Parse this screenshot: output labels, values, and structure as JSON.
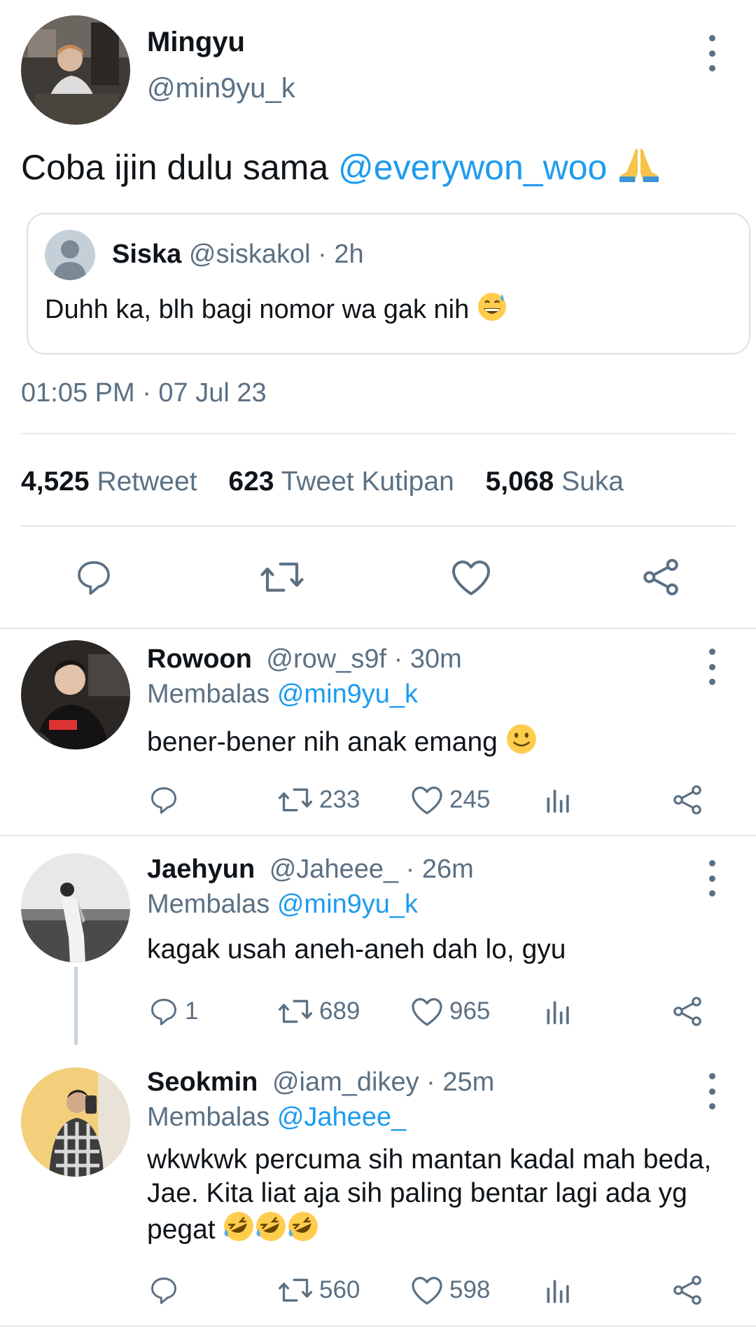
{
  "main_tweet": {
    "name": "Mingyu",
    "handle": "@min9yu_k",
    "text_prefix": "Coba ijin dulu sama ",
    "mention": "@everywon_woo",
    "emoji": "folded-hands",
    "quote": {
      "name": "Siska",
      "handle": "@siskakol",
      "separator": "·",
      "time": "2h",
      "text": "Duhh ka, blh bagi nomor wa gak nih",
      "emoji": "grinning-sweat"
    },
    "timestamp": "01:05 PM · 07 Jul 23",
    "stats": {
      "retweets": "4,525",
      "retweets_label": "Retweet",
      "quotes": "623",
      "quotes_label": "Tweet Kutipan",
      "likes": "5,068",
      "likes_label": "Suka"
    }
  },
  "replies": [
    {
      "name": "Rowoon",
      "meta": "@row_s9f · 30m",
      "reply_label": "Membalas ",
      "reply_to": "@min9yu_k",
      "text": "bener-bener nih anak emang",
      "emoji": "slightly-smiling",
      "replies_count": "",
      "retweets": "233",
      "likes": "245"
    },
    {
      "name": "Jaehyun",
      "meta": "@Jaheee_ · 26m",
      "reply_label": "Membalas ",
      "reply_to": "@min9yu_k",
      "text": "kagak usah aneh-aneh dah lo, gyu",
      "replies_count": "1",
      "retweets": "689",
      "likes": "965"
    },
    {
      "name": "Seokmin",
      "meta": "@iam_dikey · 25m",
      "reply_label": "Membalas ",
      "reply_to": "@Jaheee_",
      "text": "wkwkwk percuma sih mantan kadal mah beda, Jae. Kita liat aja sih paling bentar lagi ada yg pegat",
      "emoji": "rofl x3",
      "replies_count": "",
      "retweets": "560",
      "likes": "598"
    }
  ],
  "colors": {
    "link": "#1d9bf0",
    "muted": "#5b7083",
    "divider": "#e1e8ed"
  }
}
